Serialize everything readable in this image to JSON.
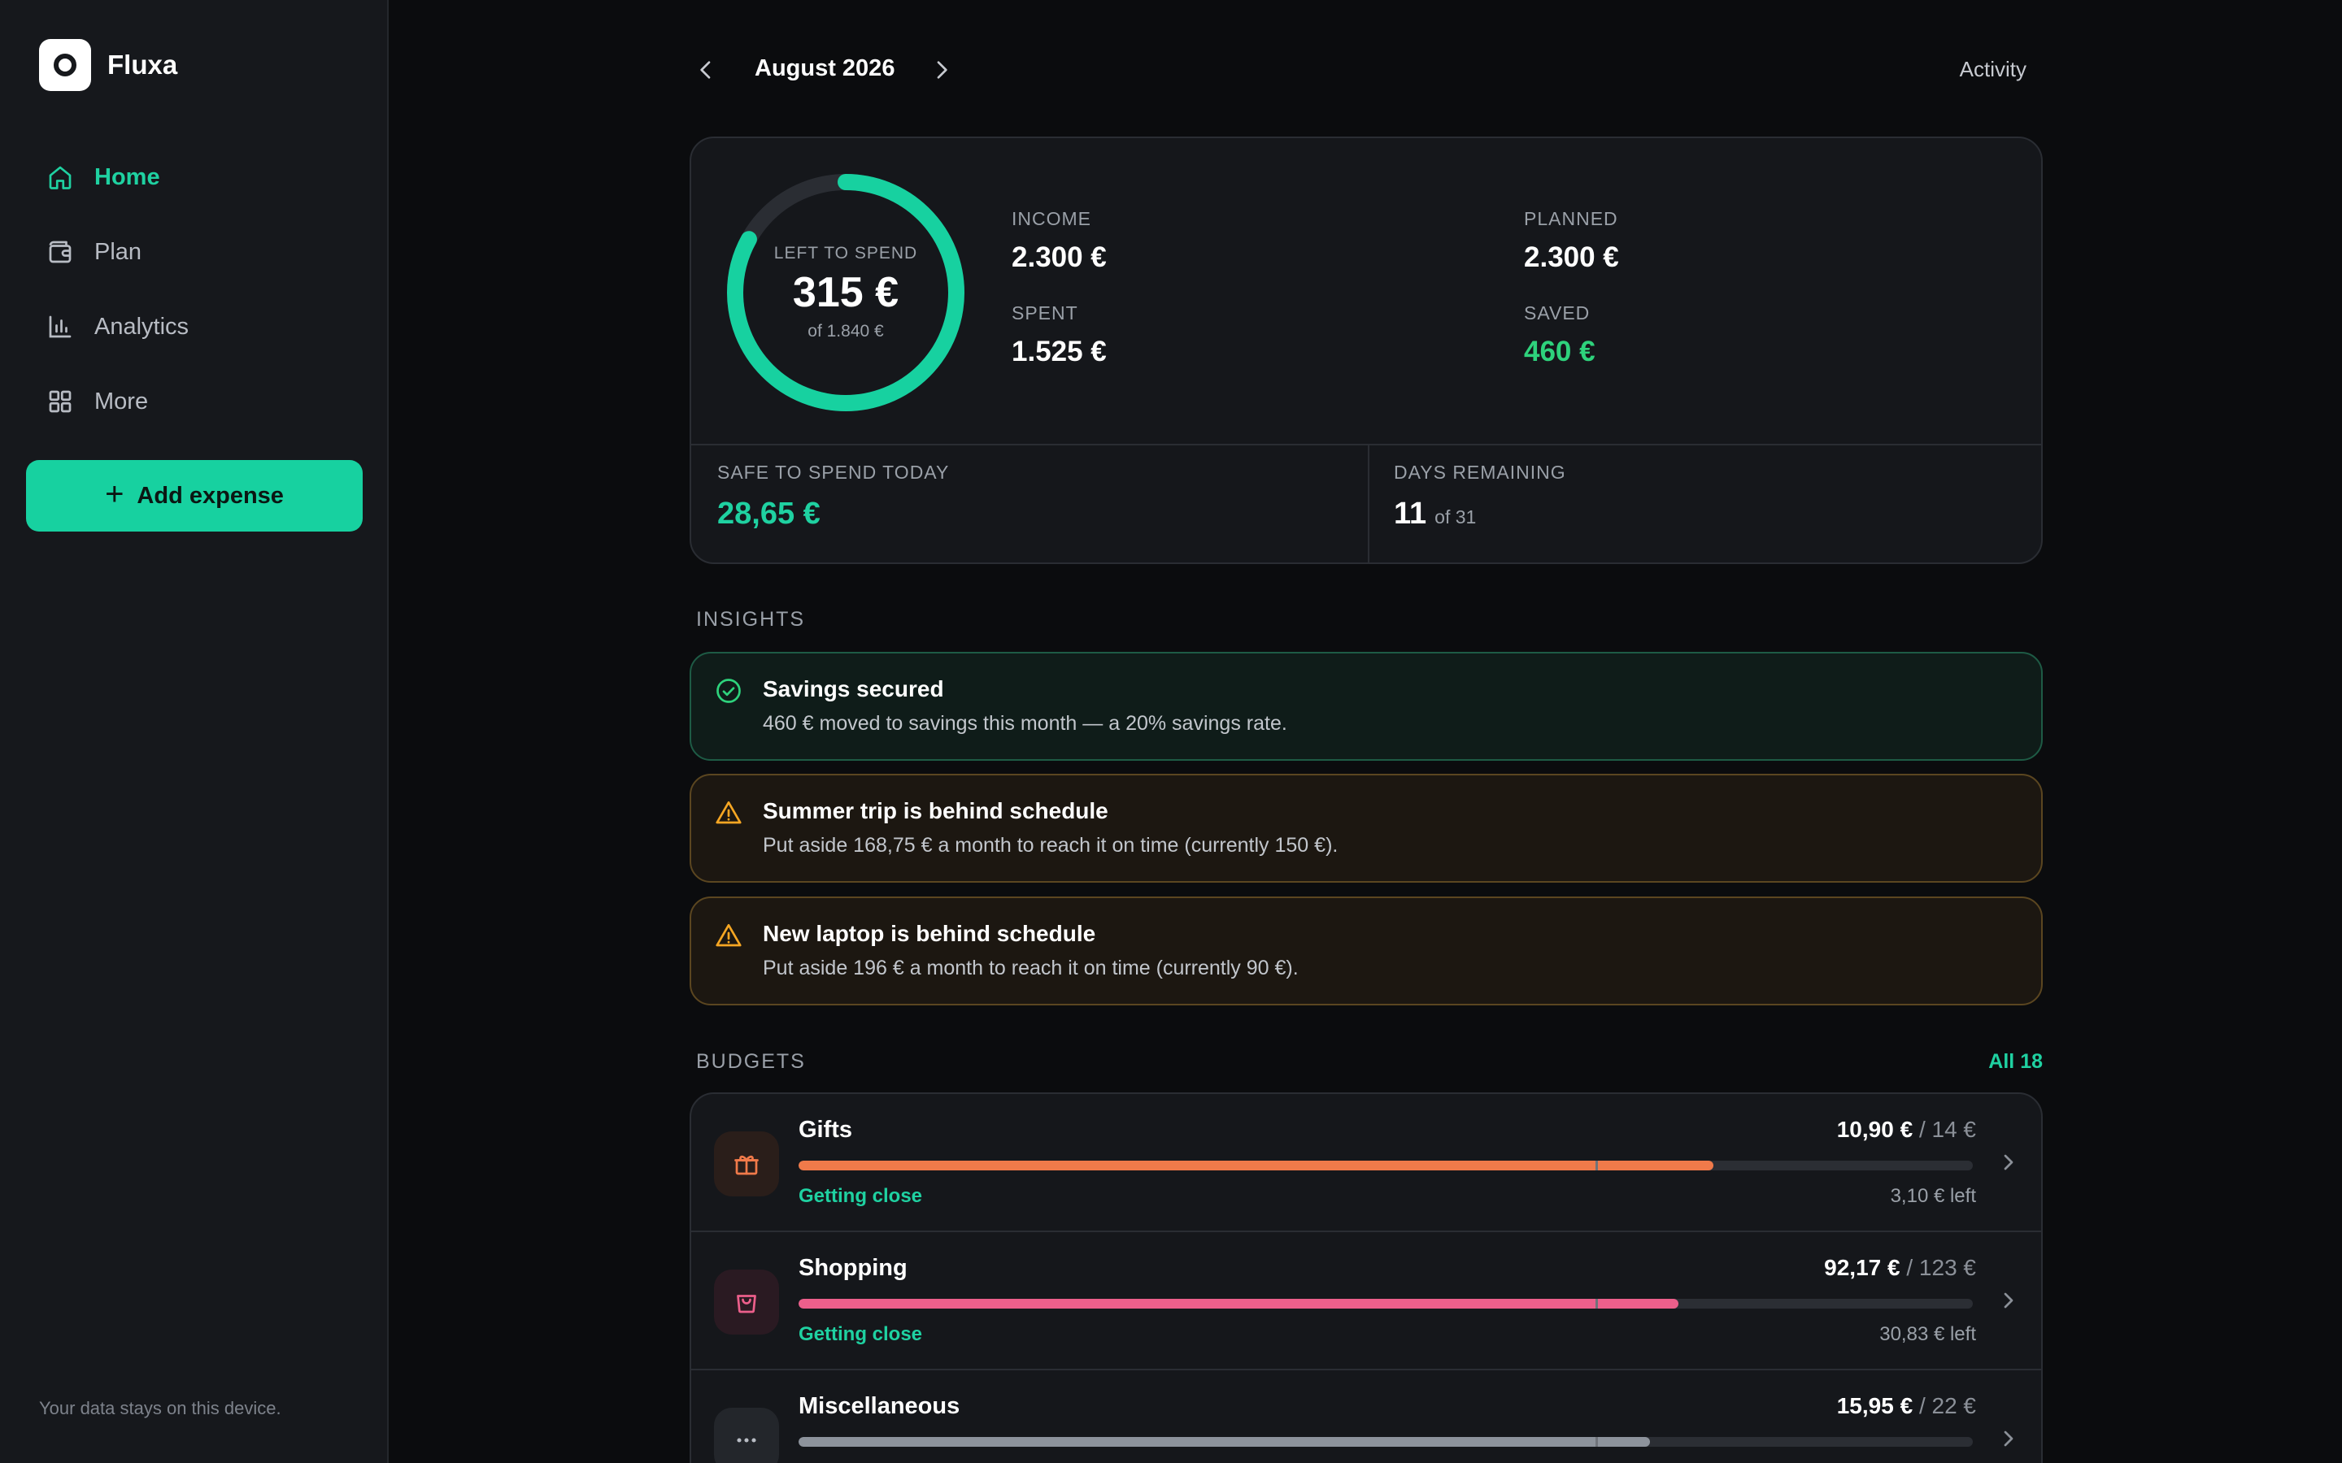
{
  "app": {
    "name": "Fluxa"
  },
  "sidebar": {
    "items": [
      {
        "label": "Home",
        "icon": "home-icon",
        "active": true
      },
      {
        "label": "Plan",
        "icon": "wallet-icon",
        "active": false
      },
      {
        "label": "Analytics",
        "icon": "bar-chart-icon",
        "active": false
      },
      {
        "label": "More",
        "icon": "grid-icon",
        "active": false
      }
    ],
    "add_button": "Add expense",
    "footnote": "Your data stays on this device."
  },
  "header": {
    "month": "August 2026",
    "activity": "Activity"
  },
  "summary": {
    "ring": {
      "label": "LEFT TO SPEND",
      "value": "315 €",
      "sub": "of 1.840 €",
      "fraction": 0.83
    },
    "income": {
      "label": "INCOME",
      "value": "2.300 €"
    },
    "spent": {
      "label": "SPENT",
      "value": "1.525 €"
    },
    "planned": {
      "label": "PLANNED",
      "value": "2.300 €"
    },
    "saved": {
      "label": "SAVED",
      "value": "460 €"
    },
    "safe_today": {
      "label": "SAFE TO SPEND TODAY",
      "value": "28,65 €"
    },
    "days_remaining": {
      "label": "DAYS REMAINING",
      "value": "11",
      "of": "of 31"
    }
  },
  "insights": {
    "title": "INSIGHTS",
    "items": [
      {
        "type": "success",
        "icon": "check-circle-icon",
        "title": "Savings secured",
        "text": "460 € moved to savings this month — a 20% savings rate."
      },
      {
        "type": "warning",
        "icon": "warning-icon",
        "title": "Summer trip is behind schedule",
        "text": "Put aside 168,75 € a month to reach it on time (currently 150 €)."
      },
      {
        "type": "warning",
        "icon": "warning-icon",
        "title": "New laptop is behind schedule",
        "text": "Put aside 196 € a month to reach it on time (currently 90 €)."
      }
    ]
  },
  "budgets": {
    "title": "BUDGETS",
    "all_link": "All 18",
    "items": [
      {
        "name": "Gifts",
        "icon": "gift-icon",
        "spent": "10,90 €",
        "total": "/ 14 €",
        "progress": 0.779,
        "status": "Getting close",
        "left": "3,10 € left",
        "color": "#f07a4a",
        "icon_bg": "#2a1e1a"
      },
      {
        "name": "Shopping",
        "icon": "shopping-bag-icon",
        "spent": "92,17 €",
        "total": "/ 123 €",
        "progress": 0.749,
        "status": "Getting close",
        "left": "30,83 € left",
        "color": "#ec5f8b",
        "icon_bg": "#2a1a22"
      },
      {
        "name": "Miscellaneous",
        "icon": "more-dots-icon",
        "spent": "15,95 €",
        "total": "/ 22 €",
        "progress": 0.725,
        "status": "",
        "left": "",
        "color": "#8d939c",
        "icon_bg": "#23262b"
      }
    ]
  }
}
